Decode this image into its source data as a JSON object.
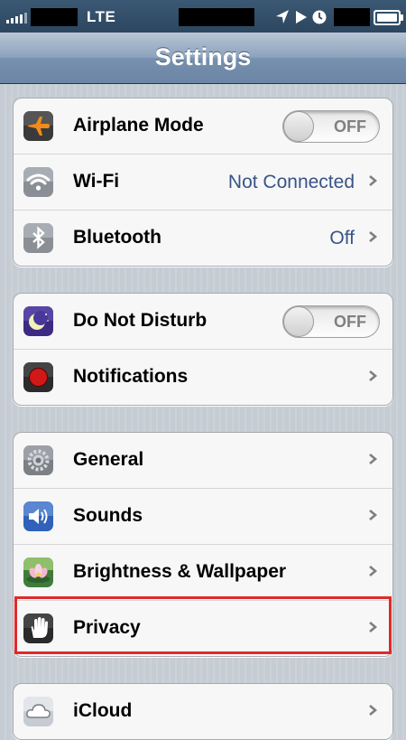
{
  "status_bar": {
    "network": "LTE",
    "icons": [
      "signal-bars-icon",
      "location-arrow-icon",
      "play-icon",
      "clock-icon",
      "battery-icon"
    ]
  },
  "nav": {
    "title": "Settings"
  },
  "groups": [
    {
      "rows": [
        {
          "label": "Airplane Mode",
          "icon": "airplane-icon",
          "toggle": "OFF"
        },
        {
          "label": "Wi-Fi",
          "icon": "wifi-icon",
          "value": "Not Connected"
        },
        {
          "label": "Bluetooth",
          "icon": "bluetooth-icon",
          "value": "Off"
        }
      ]
    },
    {
      "rows": [
        {
          "label": "Do Not Disturb",
          "icon": "moon-icon",
          "toggle": "OFF"
        },
        {
          "label": "Notifications",
          "icon": "notifications-icon"
        }
      ]
    },
    {
      "rows": [
        {
          "label": "General",
          "icon": "gear-icon"
        },
        {
          "label": "Sounds",
          "icon": "speaker-icon"
        },
        {
          "label": "Brightness & Wallpaper",
          "icon": "flower-icon"
        },
        {
          "label": "Privacy",
          "icon": "hand-icon"
        }
      ]
    },
    {
      "rows": [
        {
          "label": "iCloud",
          "icon": "cloud-icon"
        }
      ]
    }
  ],
  "colors": {
    "value_text": "#385487",
    "highlight": "#e02a2a",
    "nav_bar": "#7690af"
  }
}
